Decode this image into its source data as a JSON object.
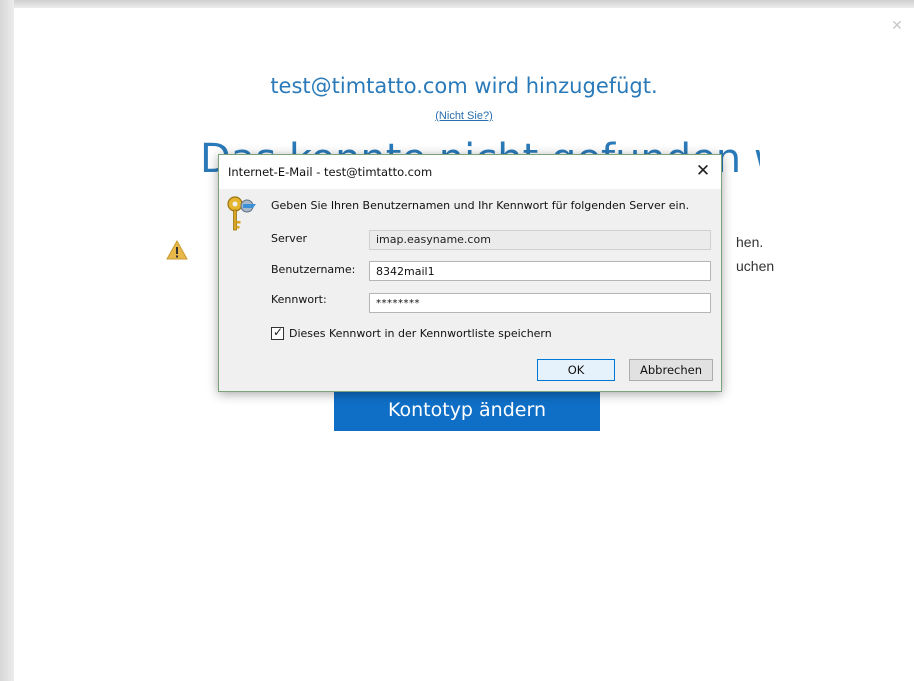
{
  "window": {
    "close_glyph": "✕"
  },
  "main": {
    "adding_title": "test@timtatto.com wird hinzugefügt.",
    "not_you_link": "(Nicht Sie?)",
    "status_heading": "Das konnte nicht gefunden werden.",
    "status_line1": "hen.",
    "status_line2": "uchen",
    "change_type_button": "Kontotyp ändern",
    "accent_color": "#2a7ab9",
    "button_color": "#0f6fc6"
  },
  "dialog": {
    "title": "Internet-E-Mail - test@timtatto.com",
    "close_glyph": "✕",
    "prompt": "Geben Sie Ihren Benutzernamen und Ihr Kennwort für folgenden Server ein.",
    "server_label": "Server",
    "server_value": "imap.easyname.com",
    "username_label": "Benutzername:",
    "username_value": "8342mail1",
    "password_label": "Kennwort:",
    "password_value": "********",
    "save_checked": true,
    "save_label": "Dieses Kennwort in der Kennwortliste speichern",
    "ok_label": "OK",
    "cancel_label": "Abbrechen",
    "icon": "keys-icon"
  },
  "icons": {
    "warning": "warning-icon",
    "checkmark": "✓"
  }
}
